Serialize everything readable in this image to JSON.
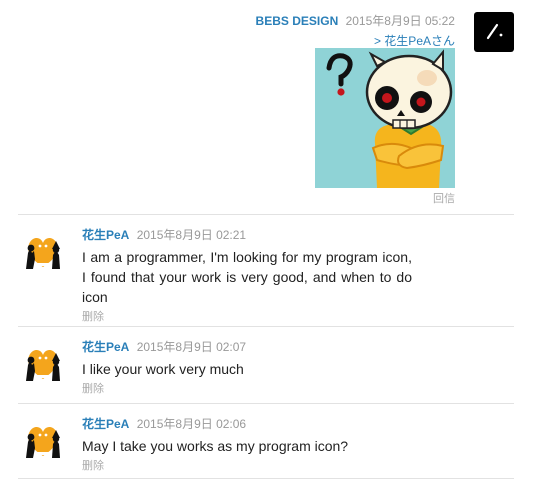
{
  "reply": {
    "author": "BEBS DESIGN",
    "time": "2015年8月9日 05:22",
    "reply_to": "> 花生PeAさん",
    "action": "回信"
  },
  "comments": [
    {
      "author": "花生PeA",
      "time": "2015年8月9日 02:21",
      "text": "I am a programmer, I'm looking for my program icon, I found that your work is very good, and when to do icon",
      "action": "删除"
    },
    {
      "author": "花生PeA",
      "time": "2015年8月9日 02:07",
      "text": "I like your work very much",
      "action": "删除"
    },
    {
      "author": "花生PeA",
      "time": "2015年8月9日 02:06",
      "text": "May I take you works as my program icon?",
      "action": "删除"
    }
  ],
  "colors": {
    "link_blue": "#2a7fb8",
    "meta_gray": "#999999",
    "sticker_bg": "#8fd3d6",
    "heart_orange": "#f4a51c"
  },
  "icons": {
    "designer_avatar": "slash-logo-icon",
    "user_avatar": "heart-silhouettes-icon",
    "sticker": "skull-question-sticker"
  }
}
